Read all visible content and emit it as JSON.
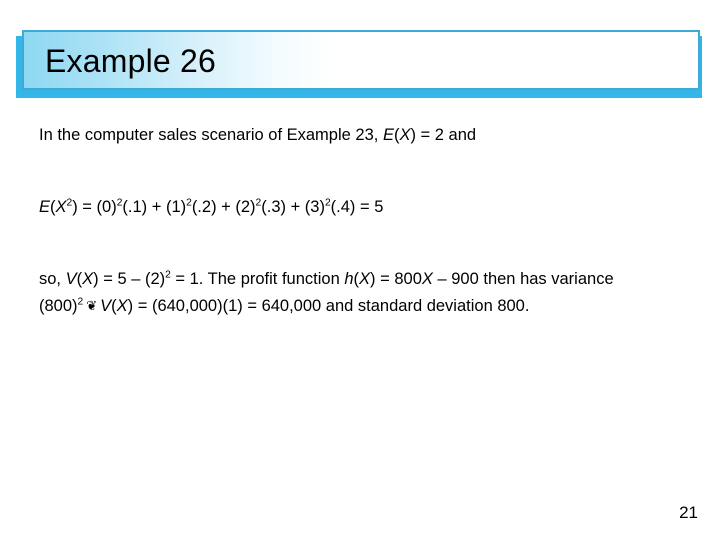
{
  "slide": {
    "title": "Example 26",
    "page_number": "21",
    "accent_color": "#35b6e8",
    "border_color": "#3fa9d8",
    "title_fill_start": "#8ed8f2",
    "title_fill_end": "#ffffff",
    "text_color": "#000000",
    "background_color": "#ffffff"
  },
  "body": {
    "paragraph1": {
      "part1": "In the computer sales scenario of Example 23, ",
      "var_e1": "E",
      "paren_open1": "(",
      "var_x1": "X",
      "paren_close1": ")",
      "part2": " = 2 and"
    },
    "paragraph2": {
      "var_e": "E",
      "paren_open": "(",
      "var_x": "X",
      "exp_x": "2",
      "paren_close": ")",
      "eq": " = (0)",
      "exp_a": "2",
      "term_a": "(.1) + (1)",
      "exp_b": "2",
      "term_b": "(.2) + (2)",
      "exp_c": "2",
      "term_c": "(.3) + (3)",
      "exp_d": "2",
      "term_d": "(.4) = 5"
    },
    "paragraph3": {
      "lead": "so, ",
      "var_v1": "V",
      "po1": "(",
      "var_x1": "X",
      "pc1": ")",
      "mid1": " = 5 – (2)",
      "exp1": "2",
      "mid2": " = 1. The profit function ",
      "var_h": "h",
      "po2": "(",
      "var_x2": "X",
      "pc2": ")",
      "mid3": " = 800",
      "var_x3": "X",
      "mid4": " – 900 then has variance (800)",
      "exp2": "2",
      "ornament": "❦",
      "var_v2": "V",
      "po3": "(",
      "var_x4": "X",
      "pc3": ")",
      "mid5": " = (640,000)(1) = 640,000 and standard deviation 800."
    }
  }
}
